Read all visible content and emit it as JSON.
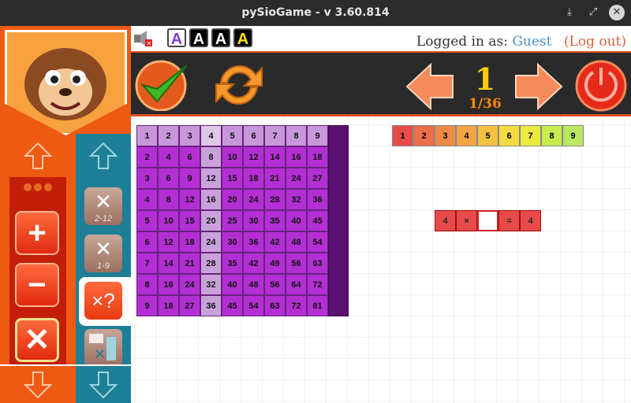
{
  "window": {
    "title": "pySioGame - v 3.60.814",
    "min": "⤓",
    "max": "⤢",
    "close": "✕"
  },
  "infobar": {
    "login_prefix": "Logged in as:",
    "user": "Guest",
    "logout": "(Log out)",
    "font_buttons": [
      "A",
      "A",
      "A",
      "A"
    ]
  },
  "counter": {
    "current": "1",
    "of": "1/36"
  },
  "side": {
    "buttons": [
      "+",
      "−",
      "✕"
    ],
    "game_labels": [
      "2-12",
      "1-9",
      "×?"
    ]
  },
  "table": [
    [
      "1",
      "2",
      "3",
      "4",
      "5",
      "6",
      "7",
      "8",
      "9"
    ],
    [
      "2",
      "4",
      "6",
      "8",
      "10",
      "12",
      "14",
      "16",
      "18"
    ],
    [
      "3",
      "6",
      "9",
      "12",
      "15",
      "18",
      "21",
      "24",
      "27"
    ],
    [
      "4",
      "8",
      "12",
      "16",
      "20",
      "24",
      "28",
      "32",
      "36"
    ],
    [
      "5",
      "10",
      "15",
      "20",
      "25",
      "30",
      "35",
      "40",
      "45"
    ],
    [
      "6",
      "12",
      "18",
      "24",
      "30",
      "36",
      "42",
      "48",
      "54"
    ],
    [
      "7",
      "14",
      "21",
      "28",
      "35",
      "42",
      "49",
      "56",
      "63"
    ],
    [
      "8",
      "16",
      "24",
      "32",
      "40",
      "48",
      "56",
      "64",
      "72"
    ],
    [
      "9",
      "18",
      "27",
      "36",
      "45",
      "54",
      "63",
      "72",
      "81"
    ]
  ],
  "digits": [
    "1",
    "2",
    "3",
    "4",
    "5",
    "6",
    "7",
    "8",
    "9"
  ],
  "digit_colors": [
    "#e84a4a",
    "#ec6f4a",
    "#ee8a46",
    "#f1a543",
    "#f3c040",
    "#f4dc3f",
    "#e9ec3f",
    "#c8ec4d",
    "#b9e861"
  ],
  "equation": [
    "4",
    "×",
    "",
    "=",
    "4"
  ],
  "colors": {
    "purple": "#b32fd3",
    "purple_light": "#c9a2dc",
    "purple_head": "#c797d9",
    "highlight": "#e0c7ea",
    "dark_col": "#5a1070"
  }
}
